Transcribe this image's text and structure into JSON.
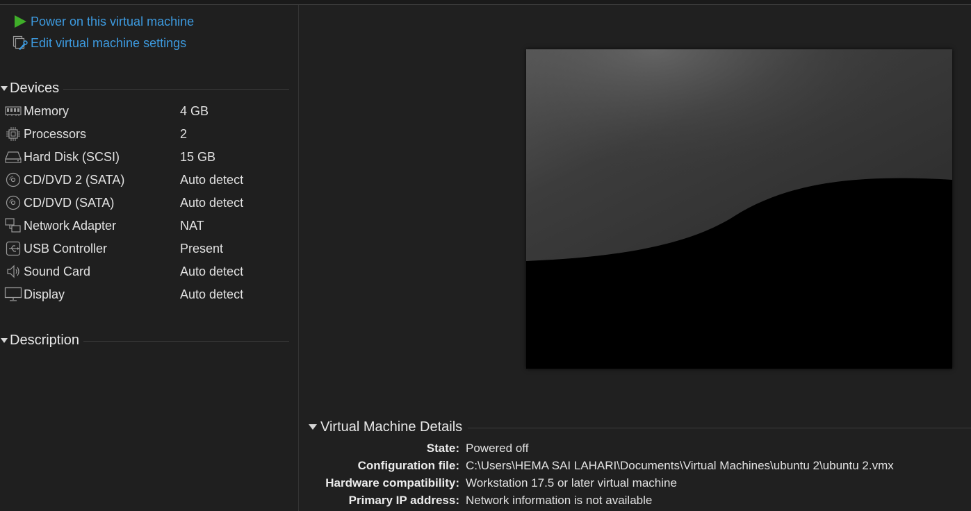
{
  "actions": {
    "power_on": "Power on this virtual machine",
    "edit_settings": "Edit virtual machine settings"
  },
  "devices": {
    "title": "Devices",
    "items": [
      {
        "name": "Memory",
        "value": "4 GB",
        "icon": "memory-icon"
      },
      {
        "name": "Processors",
        "value": "2",
        "icon": "processor-icon"
      },
      {
        "name": "Hard Disk (SCSI)",
        "value": "15 GB",
        "icon": "hard-disk-icon"
      },
      {
        "name": "CD/DVD 2 (SATA)",
        "value": "Auto detect",
        "icon": "cd-dvd-icon"
      },
      {
        "name": "CD/DVD (SATA)",
        "value": "Auto detect",
        "icon": "cd-dvd-icon"
      },
      {
        "name": "Network Adapter",
        "value": "NAT",
        "icon": "network-adapter-icon"
      },
      {
        "name": "USB Controller",
        "value": "Present",
        "icon": "usb-icon"
      },
      {
        "name": "Sound Card",
        "value": "Auto detect",
        "icon": "speaker-icon"
      },
      {
        "name": "Display",
        "value": "Auto detect",
        "icon": "monitor-icon"
      }
    ]
  },
  "description": {
    "title": "Description"
  },
  "details": {
    "title": "Virtual Machine Details",
    "rows": [
      {
        "label": "State:",
        "value": "Powered off"
      },
      {
        "label": "Configuration file:",
        "value": "C:\\Users\\HEMA SAI LAHARI\\Documents\\Virtual Machines\\ubuntu 2\\ubuntu 2.vmx"
      },
      {
        "label": "Hardware compatibility:",
        "value": "Workstation 17.5 or later virtual machine"
      },
      {
        "label": "Primary IP address:",
        "value": "Network information is not available"
      }
    ]
  },
  "colors": {
    "link": "#3d9be0",
    "play_icon": "#3fae29",
    "background": "#1f1f1f"
  }
}
